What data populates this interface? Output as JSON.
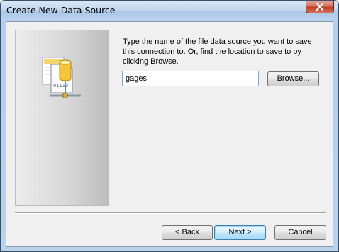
{
  "window": {
    "title": "Create New Data Source",
    "close_icon": "close-icon"
  },
  "panel": {
    "icon": "file-data-source-icon"
  },
  "instruction": "Type the name of the file data source you want to save\nthis connection to.  Or, find the location to save to by\nclicking Browse.",
  "input": {
    "value": "gages"
  },
  "buttons": {
    "browse": "Browse...",
    "back": "< Back",
    "next": "Next >",
    "cancel": "Cancel"
  }
}
